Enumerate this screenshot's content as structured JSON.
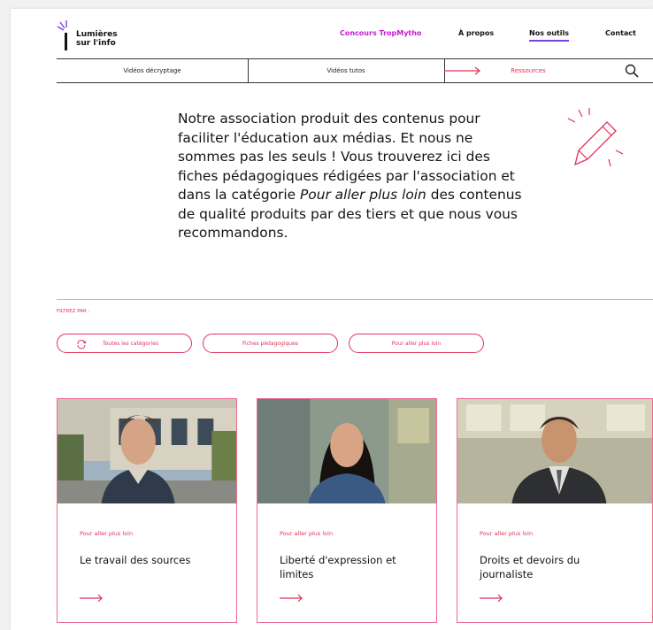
{
  "header": {
    "logo_line1": "Lumières",
    "logo_line2": "sur l'info",
    "nav": {
      "contest": "Concours TropMytho",
      "about": "À propos",
      "tools": "Nos outils",
      "contact": "Contact"
    }
  },
  "subnav": {
    "items": [
      "Vidéos décryptage",
      "Vidéos tutos",
      "Ressources"
    ]
  },
  "intro": {
    "before": "Notre association produit des contenus pour faciliter l'éducation aux médias. Et nous ne sommes pas les seuls ! Vous trouverez ici des fiches pédagogiques rédigées par l'association et dans la catégorie ",
    "emphasis": "Pour aller plus loin",
    "after": " des contenus de qualité produits par des tiers et que nous vous recommandons."
  },
  "filters": {
    "label": "FILTREZ PAR :",
    "chips": [
      "Toutes les catégories",
      "Fiches pédagogiques",
      "Pour aller plus loin"
    ]
  },
  "cards": [
    {
      "category": "Pour aller plus loin",
      "title": "Le travail des sources"
    },
    {
      "category": "Pour aller plus loin",
      "title": "Liberté d'expression et limites"
    },
    {
      "category": "Pour aller plus loin",
      "title": "Droits et devoirs du journaliste"
    }
  ],
  "colors": {
    "accent": "#e0325a",
    "brand_purple": "#7a40e0",
    "contest_magenta": "#c21ccf",
    "card_border": "#ea6d8f"
  }
}
